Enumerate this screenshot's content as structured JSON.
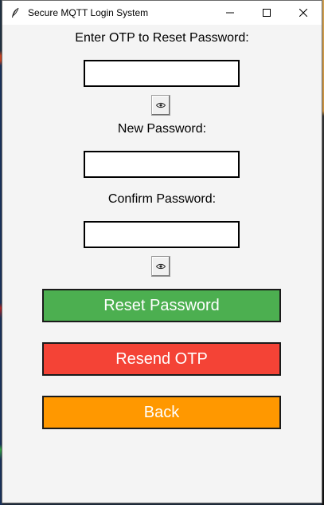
{
  "window": {
    "title": "Secure MQTT Login System"
  },
  "form": {
    "otp_label": "Enter OTP to Reset Password:",
    "otp_value": "",
    "new_password_label": "New Password:",
    "new_password_value": "",
    "confirm_password_label": "Confirm Password:",
    "confirm_password_value": ""
  },
  "buttons": {
    "reset_password": "Reset Password",
    "resend_otp": "Resend OTP",
    "back": "Back"
  },
  "colors": {
    "reset_password": "#4caf50",
    "resend_otp": "#f44336",
    "back": "#ff9800"
  },
  "icons": {
    "app": "feather-icon",
    "toggle_visibility": "eye-icon",
    "minimize": "minimize-icon",
    "maximize": "maximize-icon",
    "close": "close-icon"
  }
}
